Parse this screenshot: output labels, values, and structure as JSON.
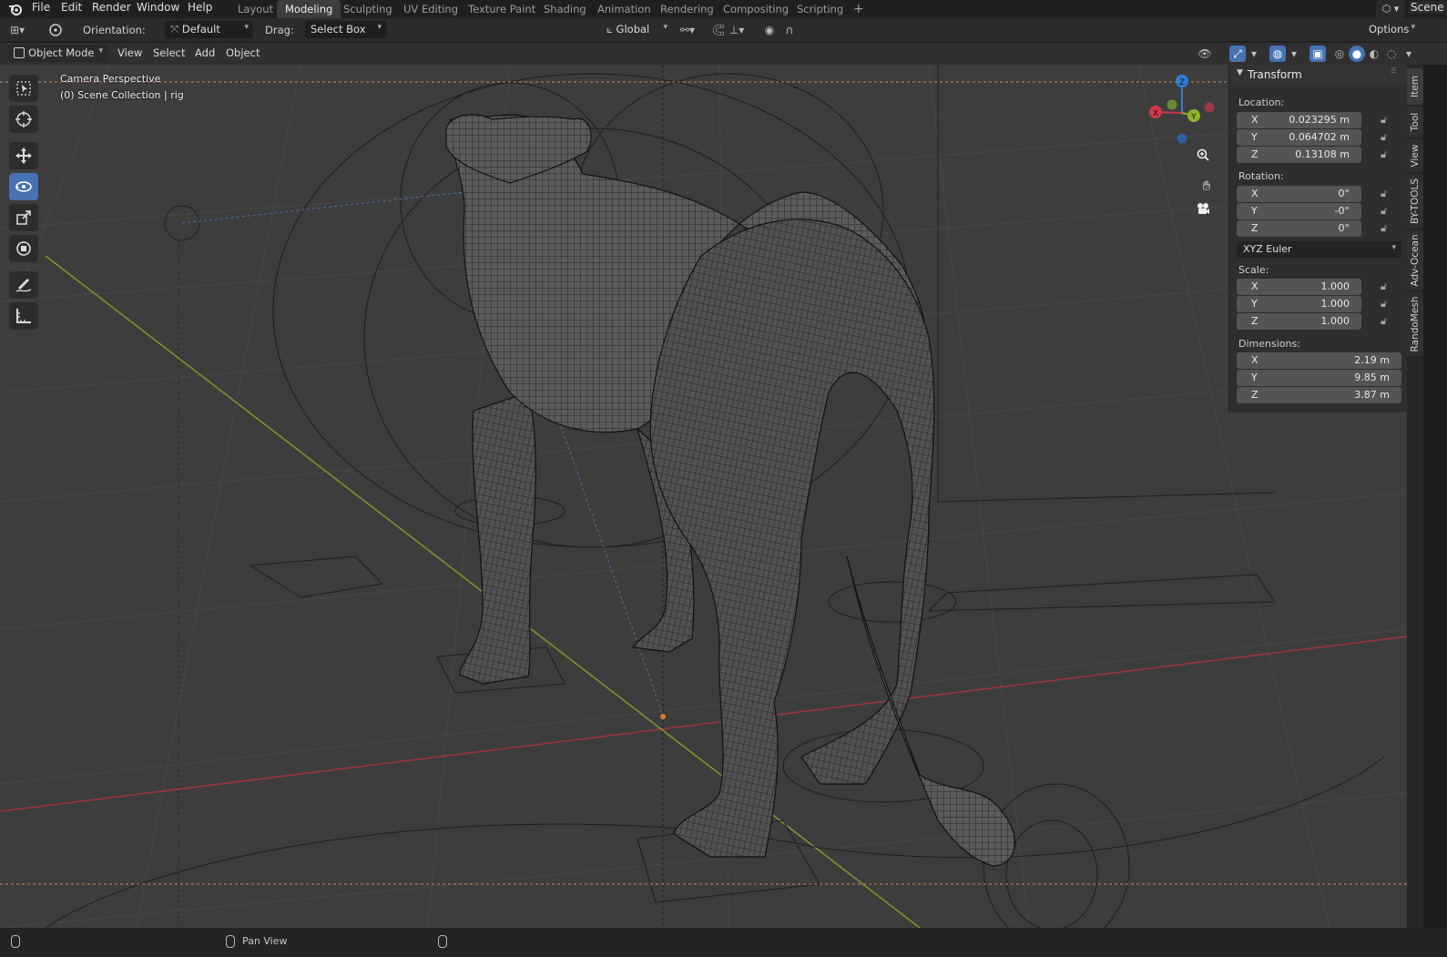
{
  "topbar": {
    "menus": [
      "File",
      "Edit",
      "Render",
      "Window",
      "Help"
    ],
    "workspaces": [
      "Layout",
      "Modeling",
      "Sculpting",
      "UV Editing",
      "Texture Paint",
      "Shading",
      "Animation",
      "Rendering",
      "Compositing",
      "Scripting"
    ],
    "active_workspace": "Modeling",
    "add_tab_symbol": "+",
    "scene_label": "Scene"
  },
  "tool_header": {
    "orientation_label": "Orientation:",
    "orientation_value": "Default",
    "drag_label": "Drag:",
    "drag_value": "Select Box",
    "transform_orientation": "Global",
    "options_label": "Options"
  },
  "viewport_header": {
    "mode": "Object Mode",
    "menus": [
      "View",
      "Select",
      "Add",
      "Object"
    ]
  },
  "viewport": {
    "camera_text": "Camera Perspective",
    "collection_text": "(0) Scene Collection | rig",
    "gizmo_axes": [
      "X",
      "Y",
      "Z"
    ],
    "colors": {
      "x_axis": "#d6364a",
      "y_axis": "#8bb52a",
      "z_axis": "#2c7fd8",
      "background": "#3d3d3d"
    }
  },
  "toolbar": {
    "tools": [
      "select-box",
      "cursor",
      "move",
      "rotate",
      "scale",
      "transform",
      "annotate",
      "measure"
    ],
    "active": "rotate"
  },
  "npanel": {
    "panel_title": "Transform",
    "location_label": "Location:",
    "location": [
      {
        "axis": "X",
        "value": "0.023295 m"
      },
      {
        "axis": "Y",
        "value": "0.064702 m"
      },
      {
        "axis": "Z",
        "value": "0.13108 m"
      }
    ],
    "rotation_label": "Rotation:",
    "rotation": [
      {
        "axis": "X",
        "value": "0°"
      },
      {
        "axis": "Y",
        "value": "-0°"
      },
      {
        "axis": "Z",
        "value": "0°"
      }
    ],
    "rotation_mode": "XYZ Euler",
    "scale_label": "Scale:",
    "scale": [
      {
        "axis": "X",
        "value": "1.000"
      },
      {
        "axis": "Y",
        "value": "1.000"
      },
      {
        "axis": "Z",
        "value": "1.000"
      }
    ],
    "dimensions_label": "Dimensions:",
    "dimensions": [
      {
        "axis": "X",
        "value": "2.19 m"
      },
      {
        "axis": "Y",
        "value": "9.85 m"
      },
      {
        "axis": "Z",
        "value": "3.87 m"
      }
    ]
  },
  "sidebar_tabs": [
    "Item",
    "Tool",
    "View",
    "BY-TOOLS",
    "Adv-Ocean",
    "RandoMesh"
  ],
  "statusbar": {
    "pan_text": "Pan View"
  }
}
